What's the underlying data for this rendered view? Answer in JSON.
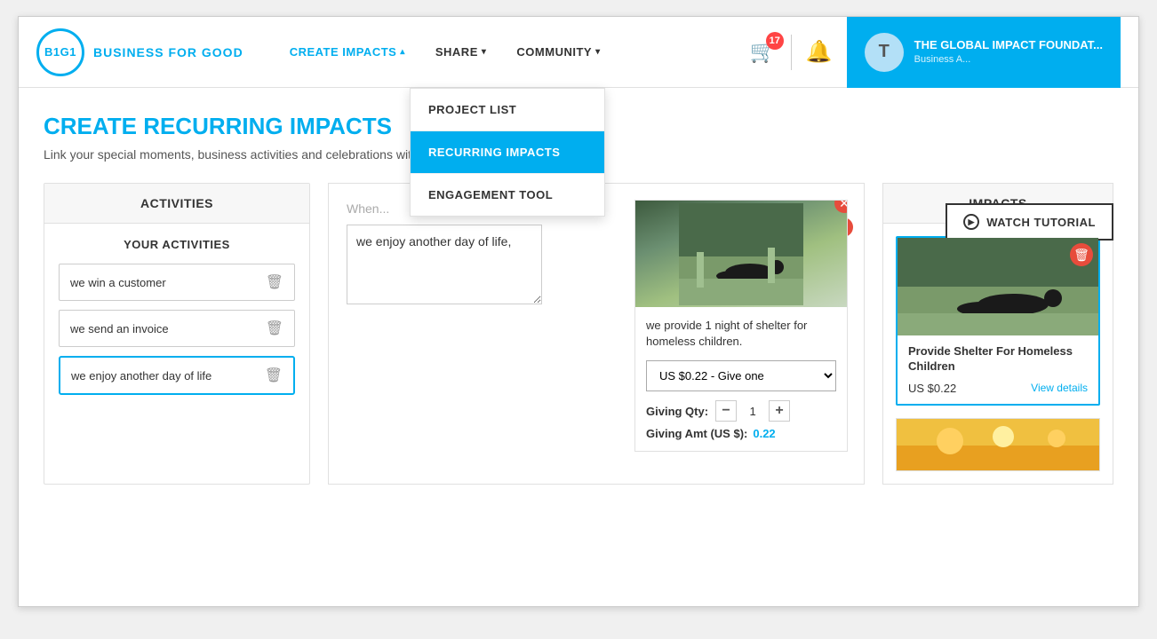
{
  "header": {
    "logo_text": "B1G1",
    "brand_name": "BUSINESS FOR GOOD",
    "nav_items": [
      {
        "id": "create-impacts",
        "label": "CREATE IMPACTS",
        "active": true,
        "has_caret": true
      },
      {
        "id": "share",
        "label": "SHARE",
        "active": false,
        "has_caret": true
      },
      {
        "id": "community",
        "label": "COMMUNITY",
        "active": false,
        "has_caret": true
      }
    ],
    "cart_count": "17",
    "user_initial": "T",
    "user_name": "THE GLOBAL IMPACT FOUNDAT...",
    "user_subtitle": "Business A..."
  },
  "dropdown": {
    "items": [
      {
        "id": "project-list",
        "label": "PROJECT LIST",
        "highlighted": false
      },
      {
        "id": "recurring-impacts",
        "label": "RECURRING IMPACTS",
        "highlighted": true
      },
      {
        "id": "engagement-tool",
        "label": "ENGAGEMENT TOOL",
        "highlighted": false
      }
    ]
  },
  "page": {
    "title": "CREATE RECURRING IMPACTS",
    "subtitle": "Link your special moments, business activities and celebrations with meaningful impacts in the world.",
    "watch_tutorial_label": "WATCH TUTORIAL"
  },
  "activities_panel": {
    "header": "ACTIVITIES",
    "your_activities_label": "YOUR ACTIVITIES",
    "items": [
      {
        "id": "win-customer",
        "text": "we win a customer",
        "selected": false
      },
      {
        "id": "send-invoice",
        "text": "we send an invoice",
        "selected": false
      },
      {
        "id": "enjoy-day",
        "text": "we enjoy another day of life",
        "selected": true
      }
    ]
  },
  "middle_panel": {
    "when_label": "When...",
    "textarea_value": "we enjoy another day of life,",
    "impact_description": "we provide 1 night of shelter for homeless children.",
    "giving_option": "US $0.22 - Give one",
    "giving_qty": "1",
    "giving_amt_label": "Giving Amt (US $):",
    "giving_amt_value": "0.22"
  },
  "impacts_panel": {
    "header": "IMPACTS",
    "impact_card": {
      "title": "Provide Shelter For Homeless Children",
      "price": "US $0.22",
      "view_details": "View details"
    }
  },
  "icons": {
    "cart": "🛒",
    "bell": "🔔",
    "trash": "🗑",
    "close": "✕",
    "play": "▶",
    "caret_down": "▾",
    "caret_up": "▴",
    "minus": "−",
    "plus": "+"
  }
}
